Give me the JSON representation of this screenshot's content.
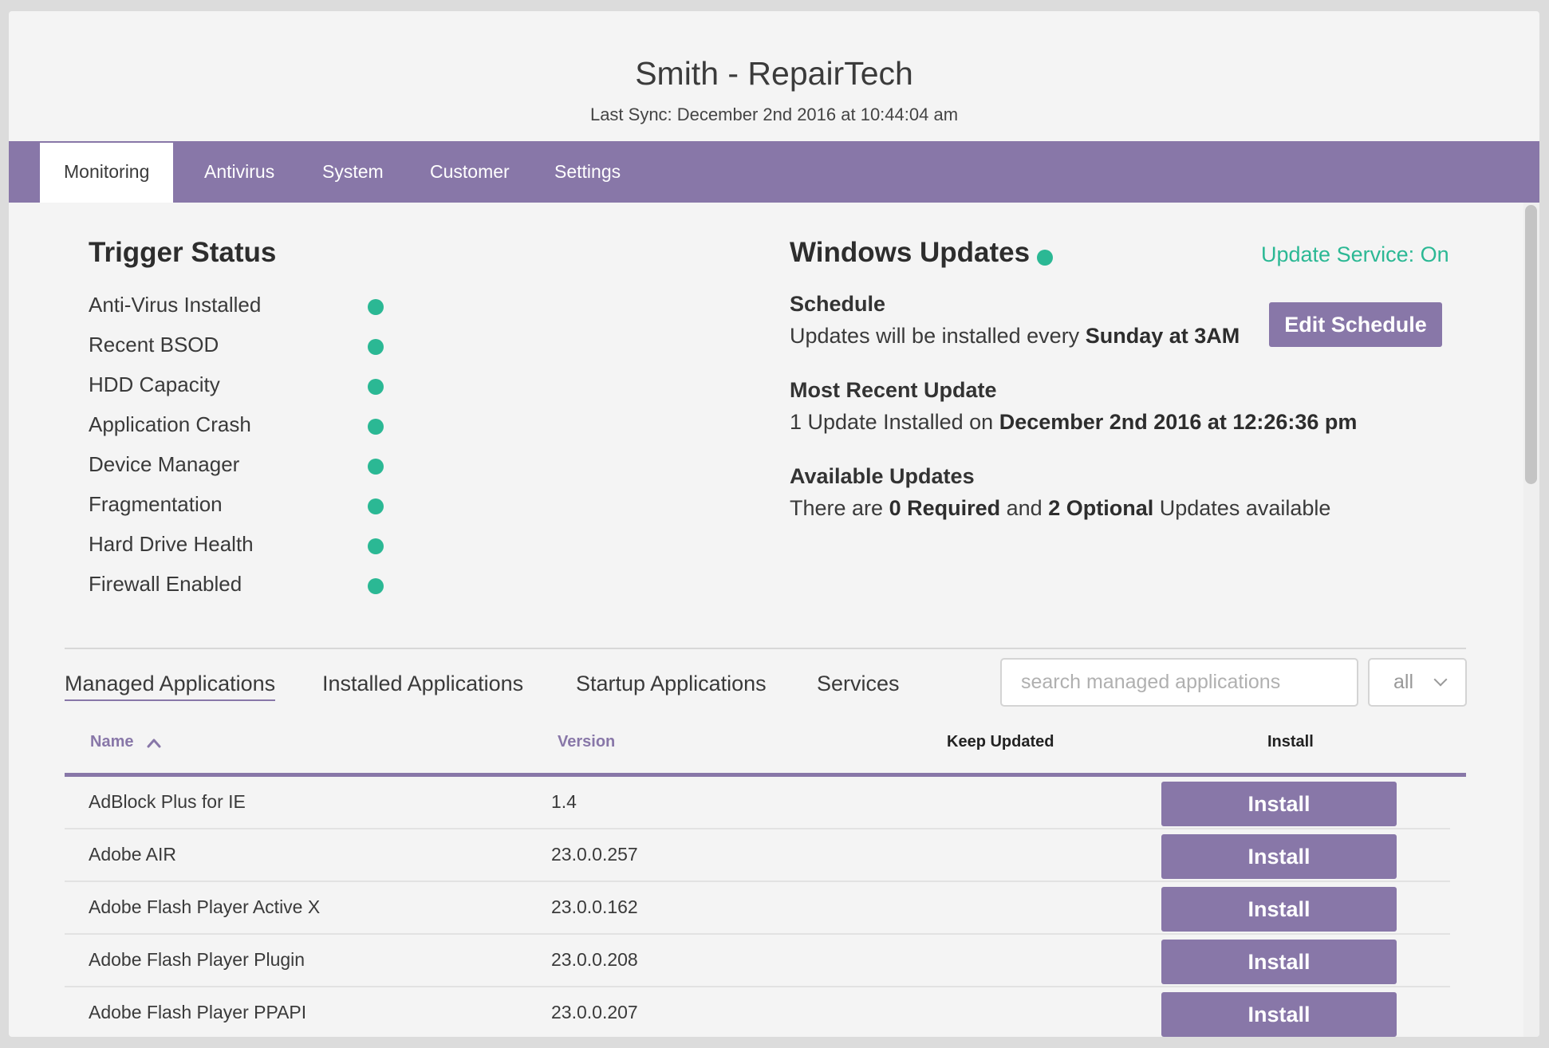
{
  "header": {
    "title": "Smith - RepairTech",
    "last_sync": "Last Sync: December 2nd 2016 at 10:44:04 am"
  },
  "tabs": [
    {
      "label": "Monitoring",
      "active": true
    },
    {
      "label": "Antivirus",
      "active": false
    },
    {
      "label": "System",
      "active": false
    },
    {
      "label": "Customer",
      "active": false
    },
    {
      "label": "Settings",
      "active": false
    }
  ],
  "trigger_status": {
    "title": "Trigger Status",
    "items": [
      {
        "label": "Anti-Virus Installed",
        "status": "ok"
      },
      {
        "label": "Recent BSOD",
        "status": "ok"
      },
      {
        "label": "HDD Capacity",
        "status": "ok"
      },
      {
        "label": "Application Crash",
        "status": "ok"
      },
      {
        "label": "Device Manager",
        "status": "ok"
      },
      {
        "label": "Fragmentation",
        "status": "ok"
      },
      {
        "label": "Hard Drive Health",
        "status": "ok"
      },
      {
        "label": "Firewall Enabled",
        "status": "ok"
      }
    ]
  },
  "windows_updates": {
    "title": "Windows Updates",
    "service_status": "Update Service: On",
    "schedule_heading": "Schedule",
    "schedule_text": "Updates will be installed every",
    "schedule_value": "Sunday at 3AM",
    "edit_schedule_label": "Edit Schedule",
    "recent_heading": "Most Recent Update",
    "recent_text": "1 Update Installed on",
    "recent_value": "December 2nd 2016 at 12:26:36 pm",
    "available_heading": "Available Updates",
    "available_prefix": "There are",
    "available_required": "0 Required",
    "available_and": "and",
    "available_optional": "2 Optional",
    "available_suffix": "Updates available"
  },
  "apps_tabs": [
    {
      "label": "Managed Applications",
      "active": true
    },
    {
      "label": "Installed Applications",
      "active": false
    },
    {
      "label": "Startup Applications",
      "active": false
    },
    {
      "label": "Services",
      "active": false
    }
  ],
  "search": {
    "placeholder": "search managed applications",
    "value": ""
  },
  "filter": {
    "selected": "all"
  },
  "table": {
    "columns": {
      "name": "Name",
      "version": "Version",
      "keep_updated": "Keep Updated",
      "install": "Install"
    },
    "rows": [
      {
        "name": "AdBlock Plus for IE",
        "version": "1.4",
        "action": "Install"
      },
      {
        "name": "Adobe AIR",
        "version": "23.0.0.257",
        "action": "Install"
      },
      {
        "name": "Adobe Flash Player Active X",
        "version": "23.0.0.162",
        "action": "Install"
      },
      {
        "name": "Adobe Flash Player Plugin",
        "version": "23.0.0.208",
        "action": "Install"
      },
      {
        "name": "Adobe Flash Player PPAPI",
        "version": "23.0.0.207",
        "action": "Install"
      }
    ]
  },
  "colors": {
    "accent": "#8877a8",
    "status_ok": "#2bb894"
  }
}
